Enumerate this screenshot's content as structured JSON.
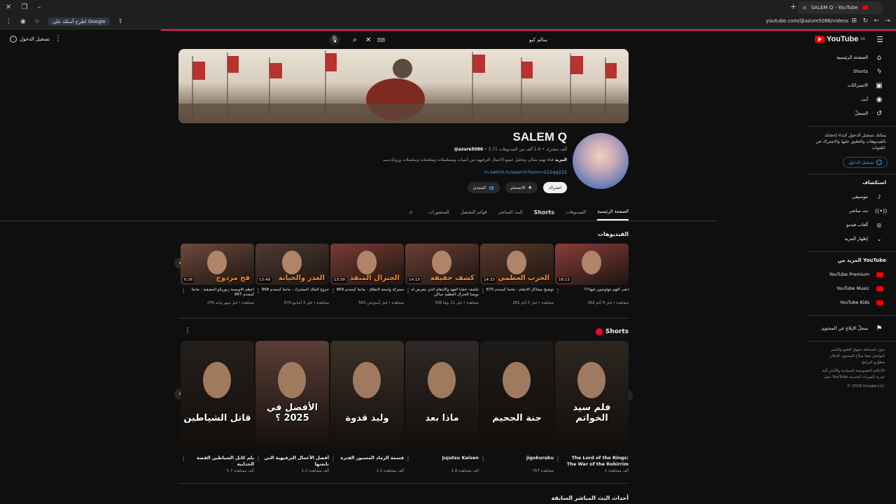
{
  "browser": {
    "tab_title": "SALEM Q - YouTube",
    "url": "youtube.com/@azure5086/videos",
    "ai_pill": "اطرح أسئلة على Google"
  },
  "topbar": {
    "signin": "تسجيل الدخول",
    "search_value": "سالم كيو",
    "logo": "YouTube",
    "logo_region": "SA"
  },
  "sidebar": {
    "nav": [
      {
        "label": "الصفحة الرئيسية",
        "icon": "home-icon",
        "glyph": "⌂"
      },
      {
        "label": "Shorts",
        "icon": "shorts-icon",
        "glyph": "ϟ"
      },
      {
        "label": "الاشتراكات",
        "icon": "subscriptions-icon",
        "glyph": "▣"
      },
      {
        "label": "أنت",
        "icon": "you-icon",
        "glyph": "◉"
      },
      {
        "label": "السجلّ",
        "icon": "history-icon",
        "glyph": "↺"
      }
    ],
    "note": "يمكنك تسجيل الدخول لإبداء إعجابك بالفيديوهات والتعليق عليها والاشتراك في القنوات.",
    "signin_btn": "تسجيل الدخول",
    "explore_title": "استكشاف",
    "explore": [
      {
        "label": "موسيقى",
        "icon": "music-icon",
        "glyph": "♪"
      },
      {
        "label": "بث مباشر",
        "icon": "live-icon",
        "glyph": "((•))"
      },
      {
        "label": "ألعاب فيديو",
        "icon": "gaming-icon",
        "glyph": "◎"
      },
      {
        "label": "إظهار المزيد",
        "icon": "chevron-down-icon",
        "glyph": "⌄"
      }
    ],
    "more_title": "المزيد من YouTube",
    "more": [
      {
        "label": "YouTube Premium"
      },
      {
        "label": "YouTube Music"
      },
      {
        "label": "YouTube Kids"
      }
    ],
    "report": "سجلّ الإبلاغ عن المحتوى",
    "footer1": "حول  الصحافة  حقوق الطبع والنشر  التواصل معنا  صنّاع المحتوى  الإعلان  مطوّرو البرامج",
    "footer2": "الأحكام  الخصوصية  السياسة والأمان  آلية عمل YouTube  تجربة الميزات الجديدة",
    "copyright": "© 2026 Google LLC"
  },
  "channel": {
    "name": "SALEM Q",
    "handle": "@azure5086",
    "meta": "3.71 ألف مشترك • 1.6 ألف من الفيديوهات",
    "desc": "قناة تهتم بتقالي وتحليل جميع الأعمال الترفيهية من أنميات ومسلسلات وملحمات وسلسلات وروايات",
    "desc_more": "...المزيد",
    "link": "m.twitch.tv/search?term=222qq222",
    "btn_subscribe": "اشتراك",
    "btn_join": "الانضمام",
    "btn_community": "المنتدى"
  },
  "tabs": [
    {
      "label": "الصفحة الرئيسية",
      "active": true
    },
    {
      "label": "الفيديوهات"
    },
    {
      "label": "Shorts"
    },
    {
      "label": "البث المباشر"
    },
    {
      "label": "قوائم التشغيل"
    },
    {
      "label": "المنشورات"
    }
  ],
  "videos_title": "الفيديوهات",
  "videos": [
    {
      "title": "أبغى كلهم يتهاوشون فيها!!؟",
      "stats": "262 مشاهدة • قبل 4 أيام",
      "duration": "16:13",
      "overlay": "",
      "bg": "#8a3d3a"
    },
    {
      "title": "توضيح مشاكل الانتقام - مانجا كينجدم 870",
      "stats": "281 مشاهدة • قبل 5 أيام",
      "duration": "14:33",
      "overlay": "الحرب العظمى",
      "bg": "#5a3a2c"
    },
    {
      "title": "تكشف خفايا العهد والانتقام الذي يتعرض له بويمبا الجنرال العظيم جياكي",
      "stats": "308 مشاهدة • قبل 11 يومًا",
      "duration": "14:15",
      "overlay": "كشف حقيقة",
      "bg": "#6b3f36"
    },
    {
      "title": "مسركة واسعة النطاق - مانجا كينجدم 869",
      "stats": "503 مشاهدة • قبل أسبوعين",
      "duration": "13:39",
      "overlay": "الجنرال المنقذ",
      "bg": "#7a3b35"
    },
    {
      "title": "خروج الملك المشترك - مانجا كينجدم 868",
      "stats": "870 مشاهدة • قبل 3 أسابيع",
      "duration": "13:49",
      "overlay": "الغدر والخيانة",
      "bg": "#4e3b33"
    },
    {
      "title": "أعظم الأوبيجية زبوريكو الحقيقية - مانجا كينجدم 867",
      "stats": "276 مشاهدة • قبل شهر واحد",
      "duration": "6:26",
      "overlay": "فخ مزدوج",
      "bg": "#6e4a3c"
    }
  ],
  "shorts_title": "Shorts",
  "shorts": [
    {
      "title": "The Lord of the Rings: The War of the Rohirrim",
      "views": "1 ألف مشاهدة",
      "overlay": "فلم سيد الخواتم",
      "bg": "#2d2620"
    },
    {
      "title": "jigokuraku",
      "views": "767 مشاهدة",
      "overlay": "جنة الجحيم",
      "bg": "#1e1a18"
    },
    {
      "title": "Jujutsu Kaisen",
      "views": "1.8 ألف مشاهدة",
      "overlay": "ماذا بعد",
      "bg": "#2e2826"
    },
    {
      "title": "قسمة الرماد المسبور الفترة",
      "views": "1.1 ألف مشاهدة",
      "overlay": "وليد قدوة",
      "bg": "#3a3026"
    },
    {
      "title": "أفضل الأعمال الترفيهية التي تابعتها",
      "views": "1.2 ألف مشاهدة",
      "overlay": "الأفضل في 2025 ؟",
      "bg": "#5a3e35"
    },
    {
      "title": "يلم كاتل الشياطين القصة الخدانية",
      "views": "1.7 ألف مشاهدة",
      "overlay": "قاتل الشياطين",
      "bg": "#241f1b"
    }
  ],
  "live_title": "أحداث البث المباشر السابقة"
}
